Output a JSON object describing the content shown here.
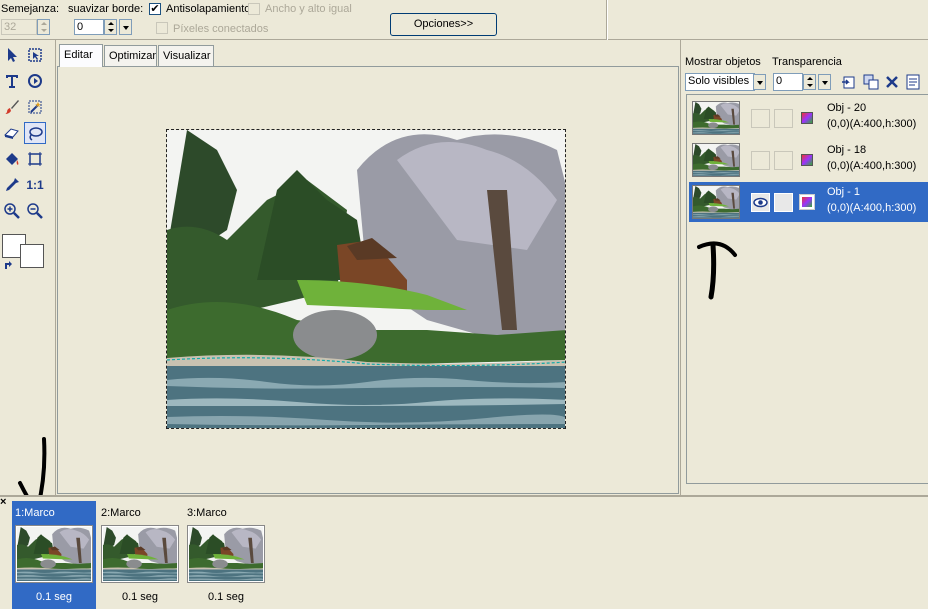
{
  "toolbar": {
    "semejanza_label": "Semejanza:",
    "semejanza_value": "32",
    "suavizar_label": "suavizar borde:",
    "suavizar_value": "0",
    "antisolapamiento_label": "Antisolapamiento",
    "antisolapamiento_checked": true,
    "ancho_alto_label": "Ancho y alto igual",
    "pixeles_label": "Píxeles conectados",
    "opciones_label": "Opciones>>"
  },
  "tools": [
    {
      "name": "arrow-icon"
    },
    {
      "name": "crop-select-icon"
    },
    {
      "name": "text-icon"
    },
    {
      "name": "rotate-icon"
    },
    {
      "name": "brush-icon"
    },
    {
      "name": "magic-wand-icon"
    },
    {
      "name": "eraser-icon"
    },
    {
      "name": "lasso-icon"
    },
    {
      "name": "paint-bucket-icon"
    },
    {
      "name": "resize-icon"
    },
    {
      "name": "eyedropper-icon"
    },
    {
      "name": "actual-size-icon",
      "text": "1:1"
    },
    {
      "name": "zoom-in-icon"
    },
    {
      "name": "zoom-out-icon"
    }
  ],
  "tabs": [
    "Editar",
    "Optimizar",
    "Visualizar"
  ],
  "objects_panel": {
    "mostrar_label": "Mostrar objetos",
    "mostrar_value": "Solo visibles",
    "transparencia_label": "Transparencia",
    "transparencia_value": "0",
    "items": [
      {
        "name": "Obj - 20",
        "info": "(0,0)(A:400,h:300)",
        "selected": false
      },
      {
        "name": "Obj - 18",
        "info": "(0,0)(A:400,h:300)",
        "selected": false
      },
      {
        "name": "Obj - 1",
        "info": "(0,0)(A:400,h:300)",
        "selected": true
      }
    ]
  },
  "frames": [
    {
      "label": "1:Marco",
      "time": "0.1 seg",
      "selected": true
    },
    {
      "label": "2:Marco",
      "time": "0.1 seg",
      "selected": false
    },
    {
      "label": "3:Marco",
      "time": "0.1 seg",
      "selected": false
    }
  ],
  "close_symbol": "×",
  "colors": {
    "selection": "#316ac5",
    "background": "#ece9d8"
  }
}
